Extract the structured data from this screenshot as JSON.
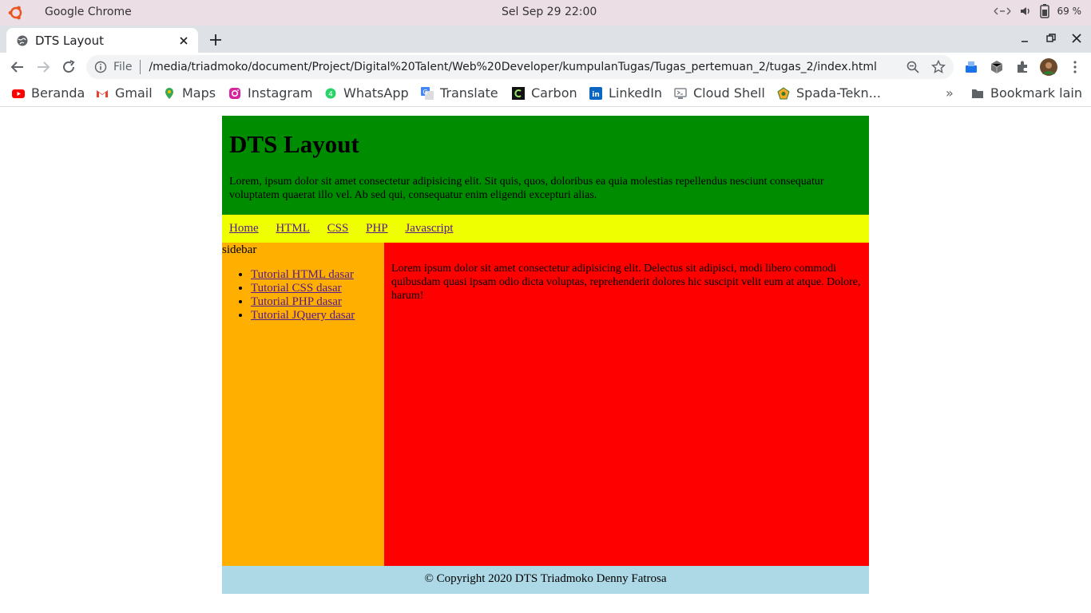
{
  "os_bar": {
    "app_name": "Google Chrome",
    "clock": "Sel Sep 29  22:00",
    "battery": "69 %"
  },
  "browser": {
    "tab_title": "DTS Layout",
    "url_scheme": "File",
    "url": "/media/triadmoko/document/Project/Digital%20Talent/Web%20Developer/kumpulanTugas/Tugas_pertemuan_2/tugas_2/index.html"
  },
  "bookmarks": {
    "items": [
      {
        "label": "Beranda",
        "icon": "youtube-icon"
      },
      {
        "label": "Gmail",
        "icon": "gmail-icon"
      },
      {
        "label": "Maps",
        "icon": "maps-icon"
      },
      {
        "label": "Instagram",
        "icon": "instagram-icon"
      },
      {
        "label": "WhatsApp",
        "icon": "whatsapp-icon"
      },
      {
        "label": "Translate",
        "icon": "translate-icon"
      },
      {
        "label": "Carbon",
        "icon": "carbon-icon"
      },
      {
        "label": "LinkedIn",
        "icon": "linkedin-icon"
      },
      {
        "label": "Cloud Shell",
        "icon": "cloud-shell-icon"
      },
      {
        "label": "Spada-Tekn...",
        "icon": "spada-icon"
      }
    ],
    "more": "»",
    "other": "Bookmark lain"
  },
  "page": {
    "title": "DTS Layout",
    "intro": "Lorem, ipsum dolor sit amet consectetur adipisicing elit. Sit quis, quos, doloribus ea quia molestias repellendus nesciunt consequatur voluptatem quaerat illo vel. Ab sed qui, consequatur enim eligendi excepturi alias.",
    "nav": [
      "Home",
      "HTML",
      "CSS",
      "PHP",
      "Javascript"
    ],
    "sidebar_label": "sidebar",
    "sidebar_links": [
      "Tutorial HTML dasar",
      "Tutorial CSS dasar",
      "Tutorial PHP dasar",
      "Tutorial JQuery dasar"
    ],
    "content": "Lorem ipsum dolor sit amet consectetur adipisicing elit. Delectus sit adipisci, modi libero commodi quibusdam quasi ipsam odio dicta voluptas, reprehenderit dolores hic suscipit velit eum at atque. Dolore, harum!",
    "footer": "© Copyright 2020 DTS Triadmoko Denny Fatrosa"
  },
  "colors": {
    "header": "#008c00",
    "nav": "#f0ff00",
    "sidebar": "#ffaf00",
    "content": "#ff0000",
    "footer": "#add8e6"
  }
}
